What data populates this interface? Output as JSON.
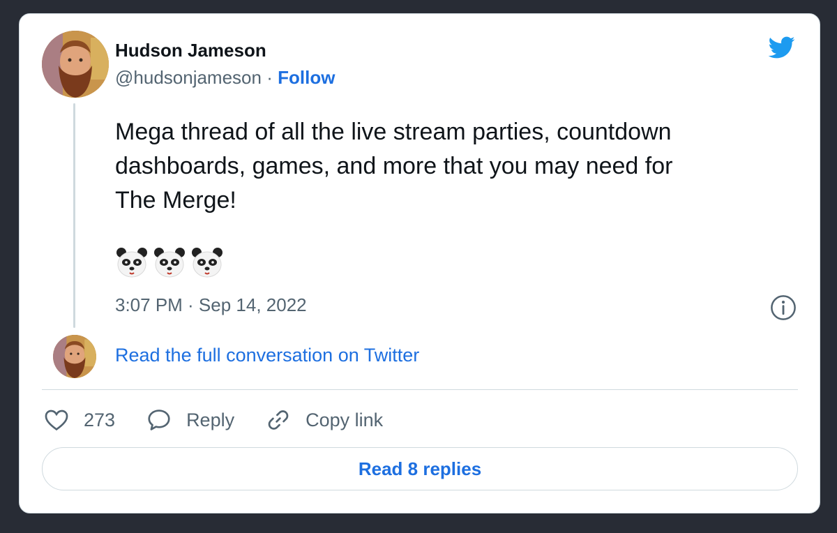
{
  "author": {
    "name": "Hudson Jameson",
    "handle": "@hudsonjameson",
    "separator": "·",
    "follow_label": "Follow"
  },
  "tweet": {
    "text_lines": [
      "Mega thread of all the live stream parties, countdown",
      "dashboards, games, and more that you may need for",
      "The Merge!"
    ],
    "emojis": [
      "panda-face",
      "panda-face",
      "panda-face"
    ],
    "timestamp": "3:07 PM · Sep 14, 2022"
  },
  "conversation": {
    "link_label": "Read the full conversation on Twitter"
  },
  "actions": {
    "likes_count": "273",
    "reply_label": "Reply",
    "copy_link_label": "Copy link"
  },
  "footer": {
    "read_replies_label": "Read 8 replies"
  },
  "icons": {
    "brand": "twitter-bird-icon",
    "info": "info-icon",
    "like": "heart-icon",
    "reply": "speech-bubble-icon",
    "copy_link": "link-icon"
  },
  "colors": {
    "background": "#282c35",
    "card": "#ffffff",
    "link_blue": "#1d6fe0",
    "twitter_blue": "#1d9bf0",
    "secondary_text": "#536471",
    "border": "#cfd9de"
  }
}
